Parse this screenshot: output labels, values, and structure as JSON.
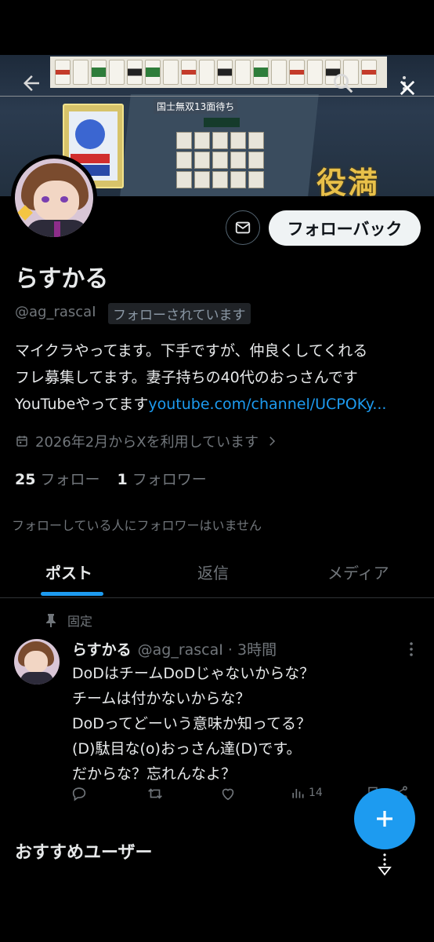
{
  "banner": {
    "yaku_caption": "国士無双13面待ち",
    "yakuman_text": "役満"
  },
  "profile": {
    "display_name": "らすかる",
    "handle": "@ag_rascaI",
    "follows_you_badge": "フォローされています",
    "bio_lines": [
      "マイクラやってます。下手ですが、仲良くしてくれる",
      "フレ募集してます。妻子持ちの40代のおっさんです"
    ],
    "bio_prefix": "YouTubeやってます",
    "bio_link": "youtube.com/channel/UCPOKy...",
    "joined": "2026年2月からXを利用しています",
    "following_count": "25",
    "following_label": "フォロー",
    "followers_count": "1",
    "followers_label": "フォロワー",
    "no_followers_note": "フォローしている人にフォロワーはいません"
  },
  "buttons": {
    "follow_back": "フォローバック"
  },
  "tabs": [
    {
      "label": "ポスト",
      "active": true
    },
    {
      "label": "返信",
      "active": false
    },
    {
      "label": "メディア",
      "active": false
    }
  ],
  "pinned_post": {
    "pinned_label": "固定",
    "author_name": "らすかる",
    "author_handle": "@ag_rascaI",
    "separator": "·",
    "time": "3時間",
    "lines": [
      "DoDはチームDoDじゃないからな？",
      "チームは付かないからな？",
      "DoDってどーいう意味か知ってる？",
      "(D)駄目な(o)おっさん達(D)です。",
      "だからな？忘れんなよ？"
    ],
    "views": "14"
  },
  "section": {
    "recommended_users": "おすすめユーザー"
  },
  "colors": {
    "accent": "#1d9bf0",
    "background": "#000000",
    "secondary_text": "#71767b"
  }
}
